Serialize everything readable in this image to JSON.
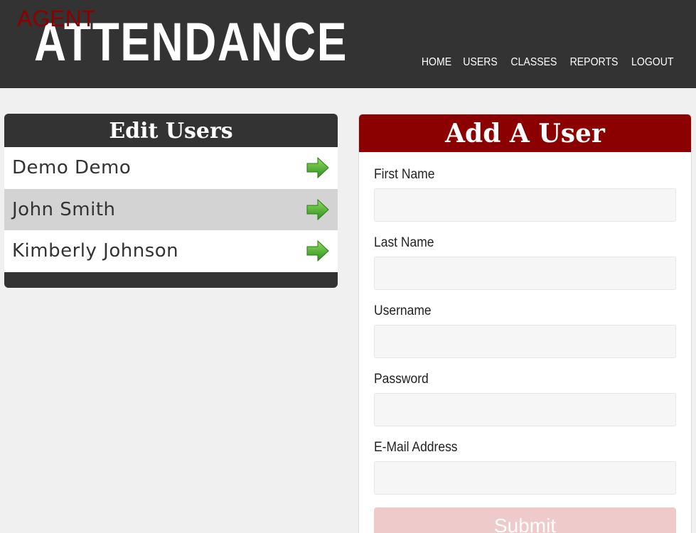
{
  "header": {
    "logo_small": "AGENT",
    "logo_main": "ATTENDANCE",
    "nav": [
      {
        "label": "HOME"
      },
      {
        "label": "USERS"
      },
      {
        "label": "CLASSES"
      },
      {
        "label": "REPORTS"
      },
      {
        "label": "LOGOUT"
      }
    ]
  },
  "edit_users": {
    "title": "Edit Users",
    "users": [
      {
        "name": "Demo Demo",
        "icon": "arrow-right-icon"
      },
      {
        "name": "John Smith",
        "icon": "arrow-right-icon"
      },
      {
        "name": "Kimberly Johnson",
        "icon": "arrow-right-icon"
      }
    ]
  },
  "add_user": {
    "title": "Add A User",
    "fields": [
      {
        "label": "First Name",
        "value": ""
      },
      {
        "label": "Last Name",
        "value": ""
      },
      {
        "label": "Username",
        "value": ""
      },
      {
        "label": "Password",
        "value": ""
      },
      {
        "label": "E-Mail Address",
        "value": ""
      }
    ],
    "submit_label": "Submit"
  },
  "colors": {
    "header_bg": "#333333",
    "brand_red": "#8b0000",
    "page_bg": "#f0f0f0",
    "row_alt": "#d3d3d3",
    "arrow_green": "#3aa02a",
    "submit_disabled": "#efcaca"
  }
}
